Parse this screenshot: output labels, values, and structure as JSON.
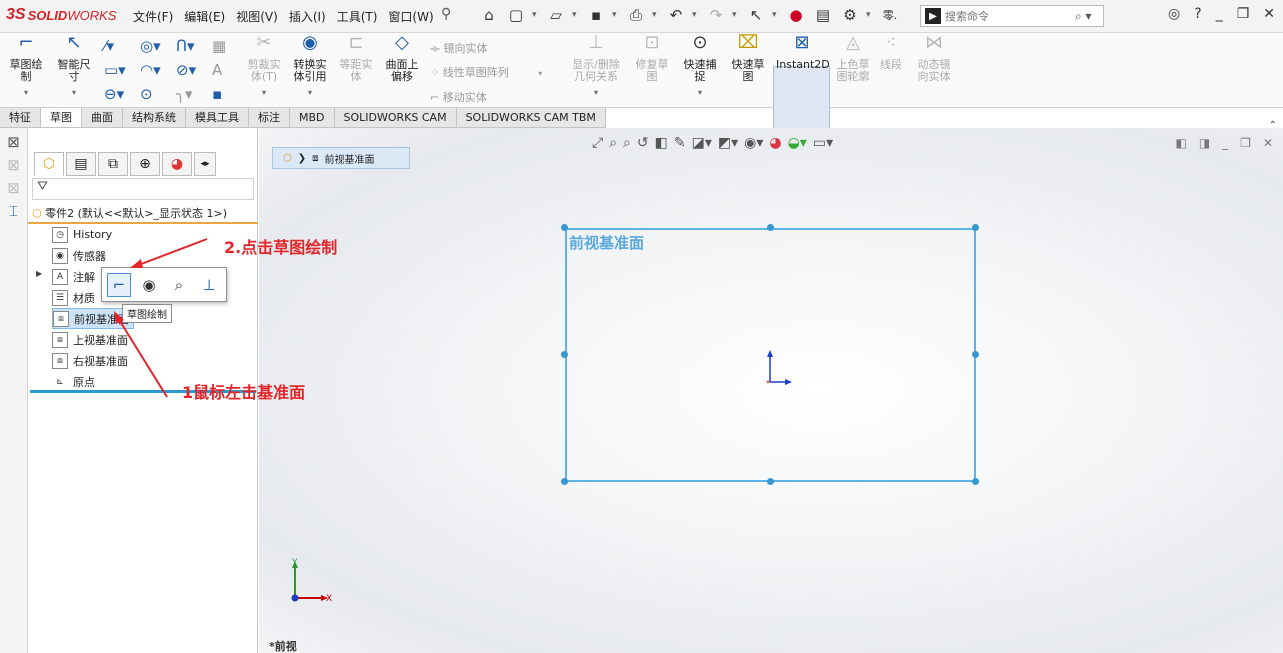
{
  "app": {
    "logo_ds": "3S",
    "logo_solid": "SOLID",
    "logo_works": "WORKS"
  },
  "menu": [
    "文件(F)",
    "编辑(E)",
    "视图(V)",
    "插入(I)",
    "工具(T)",
    "窗口(W)"
  ],
  "search": {
    "placeholder": "搜索命令"
  },
  "ribbon": {
    "sketch": "草图绘制",
    "smart_dim": "智能尺寸",
    "trim": "剪裁实体(T)",
    "convert": "转换实体引用",
    "offset": "等距实体",
    "surface_offset": "曲面上偏移",
    "mirror": "镜向实体",
    "linear_pattern": "线性草图阵列",
    "move": "移动实体",
    "show_relations": "显示/删除几何关系",
    "repair": "修复草图",
    "quick_snap": "快速捕捉",
    "rapid_sketch": "快速草图",
    "instant2d": "Instant2D",
    "shaded_contours": "上色草图轮廓",
    "segment": "线段",
    "dynamic_mirror": "动态镜向实体"
  },
  "tabs": [
    "特征",
    "草图",
    "曲面",
    "结构系统",
    "模具工具",
    "标注",
    "MBD",
    "SOLIDWORKS CAM",
    "SOLIDWORKS CAM TBM"
  ],
  "tree": {
    "root": "零件2 (默认<<默认>_显示状态 1>)",
    "items": [
      "History",
      "传感器",
      "注解",
      "材质",
      "前视基准面",
      "上视基准面",
      "右视基准面",
      "原点"
    ]
  },
  "context": {
    "tooltip": "草图绘制"
  },
  "graphics": {
    "breadcrumb": "前视基准面",
    "plane_label": "前视基准面",
    "view_name": "*前视",
    "triad_x": "X",
    "triad_y": "Y"
  },
  "annotations": {
    "step2": "2.点击草图绘制",
    "step1": "1鼠标左击基准面"
  },
  "colors": {
    "annotation": "#e3252a",
    "plane": "#5db3e5",
    "brand": "#d2232a"
  }
}
